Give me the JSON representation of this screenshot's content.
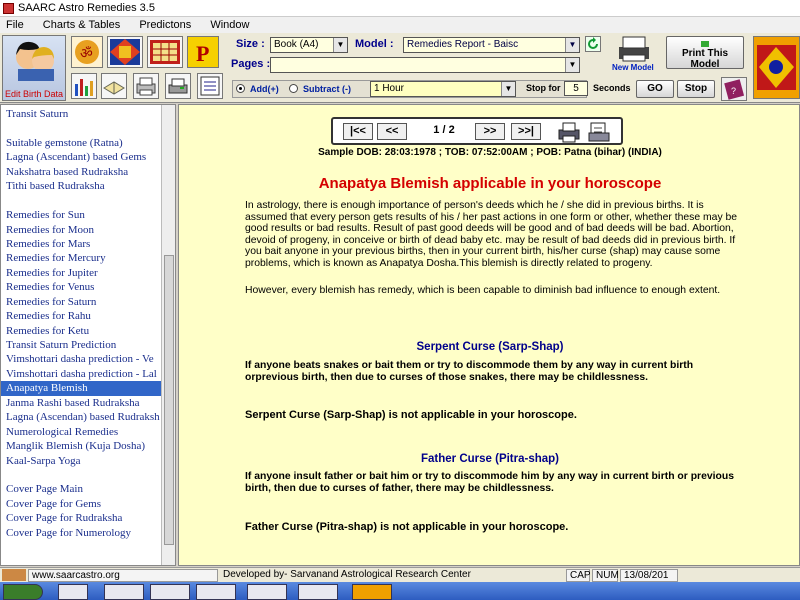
{
  "window": {
    "title": "SAARC Astro Remedies 3.5"
  },
  "menu": [
    "File",
    "Charts & Tables",
    "Predictons",
    "Window"
  ],
  "toolbar": {
    "avatar_label": "Edit Birth Data",
    "size_label": "Size :",
    "size_value": "Book (A4)",
    "model_label": "Model :",
    "model_value": "Remedies Report - Baisc",
    "pages_label": "Pages :",
    "new_model_label": "New Model",
    "print_model_label": "Print This Model",
    "add_label": "Add(+)",
    "subtract_label": "Subtract (-)",
    "interval_value": "1 Hour",
    "stop_for_label": "Stop for",
    "stop_for_value": "5",
    "seconds_label": "Seconds",
    "go_label": "GO",
    "stop_label": "Stop"
  },
  "sidebar": {
    "items": [
      "Transit Saturn",
      "",
      "Suitable gemstone (Ratna)",
      "Lagna (Ascendant) based Gems",
      "Nakshatra based Rudraksha",
      "Tithi based Rudraksha",
      "",
      "Remedies for Sun",
      "Remedies for Moon",
      "Remedies for Mars",
      "Remedies for Mercury",
      "Remedies for Jupiter",
      "Remedies for Venus",
      "Remedies for Saturn",
      "Remedies for Rahu",
      "Remedies for Ketu",
      "Transit Saturn Prediction",
      "Vimshottari dasha prediction - Ve",
      "Vimshottari dasha prediction - Lal",
      "Anapatya Blemish",
      "Janma Rashi based Rudraksha",
      "Lagna (Ascendan) based Rudraksh",
      "Numerological Remedies",
      "Manglik Blemish (Kuja Dosha)",
      "Kaal-Sarpa Yoga",
      "",
      "Cover Page Main",
      "Cover Page for Gems",
      "Cover Page for Rudraksha",
      "Cover Page for Numerology"
    ],
    "selected_index": 19
  },
  "content": {
    "nav": {
      "first": "|<<",
      "prev": "<<",
      "page": "1 / 2",
      "next": ">>",
      "last": ">>|"
    },
    "sample_info": "Sample DOB: 28:03:1978 ; TOB: 07:52:00AM ; POB: Patna (bihar) (INDIA)",
    "title": "Anapatya Blemish applicable in your horoscope",
    "intro": "In astrology, there is enough importance of person's deeds which he / she did in previous births. It is assumed that every person gets results of his / her past actions in one form or other, whether these may be good results or bad results. Result of past good deeds will be good and of bad deeds will be bad. Abortion, devoid of progeny, in conceive or birth of dead baby etc. may be result of bad deeds did in previous birth. If you bait anyone in your previous births, then in your current birth, his/her curse (shap) may cause some problems, which is known as Anapatya Dosha.This blemish is directly related to progeny.",
    "remedy_note": "However, every blemish has remedy, which is been capable to diminish bad influence to enough extent.",
    "serpent_head": "Serpent Curse (Sarp-Shap)",
    "serpent_desc": "If anyone beats snakes or bait them or try to discommode them by any way in current birth orprevious birth, then due to curses of those snakes, there may be childlessness.",
    "serpent_result": "Serpent Curse (Sarp-Shap) is not applicable in your horoscope.",
    "father_head": "Father Curse (Pitra-shap)",
    "father_desc": "If anyone insult father or bait him or try to discommode him by any way in current birth or previous birth, then due to curses of father, there may be childlessness.",
    "father_result": "Father Curse (Pitra-shap) is not applicable in your horoscope."
  },
  "status": {
    "website": "www.saarcastro.org",
    "developer": "Developed by- Sarvanand Astrological Research Center",
    "cap": "CAP",
    "num": "NUM",
    "date": "13/08/201"
  },
  "colors": {
    "content_bg": "#ffffc8",
    "title_red": "#d40000",
    "subhead_blue": "#00008b",
    "selection": "#3166c8"
  }
}
